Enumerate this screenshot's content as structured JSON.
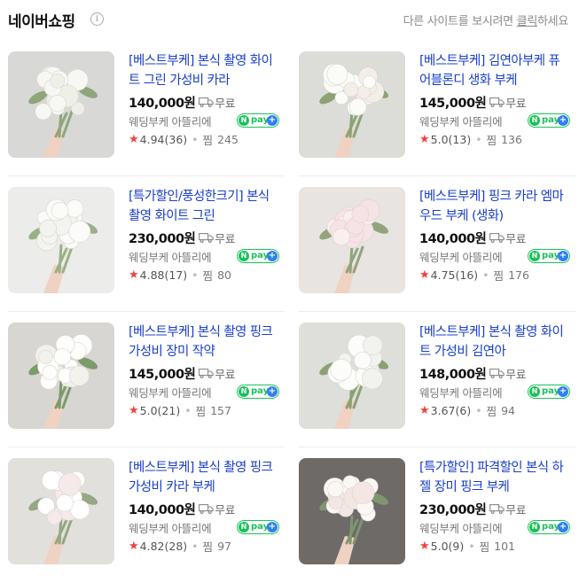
{
  "header": {
    "title": "네이버쇼핑",
    "info_icon": "info-icon",
    "notice_prefix": "다른 사이트를 보시려면 ",
    "notice_link": "클릭",
    "notice_suffix": "하세요"
  },
  "products_left": [
    {
      "name": "[베스트부케] 본식 촬영 화이트 그린 가성비 카라",
      "price": "140,000원",
      "shipping": "무료",
      "seller": "웨딩부케 아뜰리에",
      "rating": "4.94",
      "review_count": "(36)",
      "zzim_label": "찜",
      "zzim": "245"
    },
    {
      "name": "[특가할인/풍성한크기] 본식 촬영 화이트 그린",
      "price": "230,000원",
      "shipping": "무료",
      "seller": "웨딩부케 아뜰리에",
      "rating": "4.88",
      "review_count": "(17)",
      "zzim_label": "찜",
      "zzim": "80"
    },
    {
      "name": "[베스트부케] 본식 촬영 핑크 가성비 장미 작약",
      "price": "145,000원",
      "shipping": "무료",
      "seller": "웨딩부케 아뜰리에",
      "rating": "5.0",
      "review_count": "(21)",
      "zzim_label": "찜",
      "zzim": "157"
    },
    {
      "name": "[베스트부케] 본식 촬영 핑크 가성비 카라 부케",
      "price": "140,000원",
      "shipping": "무료",
      "seller": "웨딩부케 아뜰리에",
      "rating": "4.82",
      "review_count": "(28)",
      "zzim_label": "찜",
      "zzim": "97"
    }
  ],
  "products_right": [
    {
      "name": "[베스트부케] 김연아부케 퓨어블론디 생화 부케",
      "price": "145,000원",
      "shipping": "무료",
      "seller": "웨딩부케 아뜰리에",
      "rating": "5.0",
      "review_count": "(13)",
      "zzim_label": "찜",
      "zzim": "136"
    },
    {
      "name": "[베스트부케] 핑크 카라 엠마우드 부케 (생화)",
      "price": "140,000원",
      "shipping": "무료",
      "seller": "웨딩부케 아뜰리에",
      "rating": "4.75",
      "review_count": "(16)",
      "zzim_label": "찜",
      "zzim": "176"
    },
    {
      "name": "[베스트부케] 본식 촬영 화이트 가성비 김연아",
      "price": "148,000원",
      "shipping": "무료",
      "seller": "웨딩부케 아뜰리에",
      "rating": "3.67",
      "review_count": "(6)",
      "zzim_label": "찜",
      "zzim": "94"
    },
    {
      "name": "[특가할인] 파격할인 본식 하젤 장미 핑크 부케",
      "price": "230,000원",
      "shipping": "무료",
      "seller": "웨딩부케 아뜰리에",
      "rating": "5.0",
      "review_count": "(9)",
      "zzim_label": "찜",
      "zzim": "101"
    }
  ],
  "npay": {
    "n": "N",
    "pay": "pay",
    "plus": "+"
  },
  "colors": {
    "title_link": "#1a3fc7",
    "star": "#f24040",
    "npay_green": "#19c25a",
    "npay_blue": "#2f7ef4"
  },
  "icons": {
    "truck": "truck-icon",
    "star": "star-icon"
  }
}
